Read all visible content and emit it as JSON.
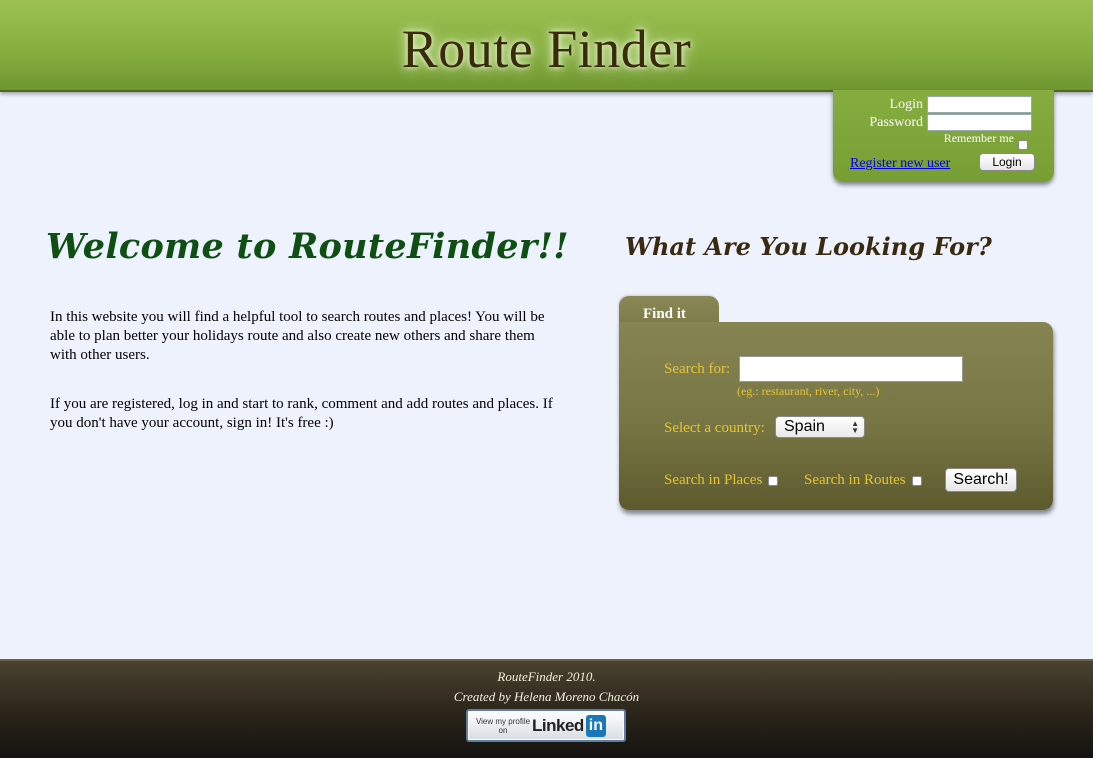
{
  "header": {
    "title": "Route Finder"
  },
  "login": {
    "login_label": "Login",
    "password_label": "Password",
    "login_value": "",
    "password_value": "",
    "remember_label": "Remember me",
    "remember_checked": false,
    "register_link": "Register new user",
    "login_button": "Login"
  },
  "welcome": {
    "title": "Welcome to RouteFinder!!",
    "paragraph1": "In this website you will find a helpful tool to search routes and places! You will be able to plan better your holidays route and also create new others and share them with other users.",
    "paragraph2": "If you are registered, log in and start to rank, comment and add routes and places. If you don't have your account, sign in! It's free :)"
  },
  "search": {
    "heading": "What Are You Looking For?",
    "tab_label": "Find it",
    "search_for_label": "Search for:",
    "search_value": "",
    "hint": "(eg.: restaurant, river, city, ...)",
    "country_label": "Select a country:",
    "country_selected": "Spain",
    "places_label": "Search in Places",
    "places_checked": false,
    "routes_label": "Search in Routes",
    "routes_checked": false,
    "search_button": "Search!"
  },
  "footer": {
    "line1": "RouteFinder 2010.",
    "line2": "Created by Helena Moreno Chacón",
    "badge_view": "View my profile on",
    "badge_brand": "Linked",
    "badge_in": "in"
  },
  "colors": {
    "header_green": "#84ad3e",
    "title_brown": "#3a2a0e",
    "welcome_green": "#0f4f14",
    "panel_olive": "#787544",
    "panel_label_yellow": "#e4c534",
    "background": "#eef2fd"
  }
}
